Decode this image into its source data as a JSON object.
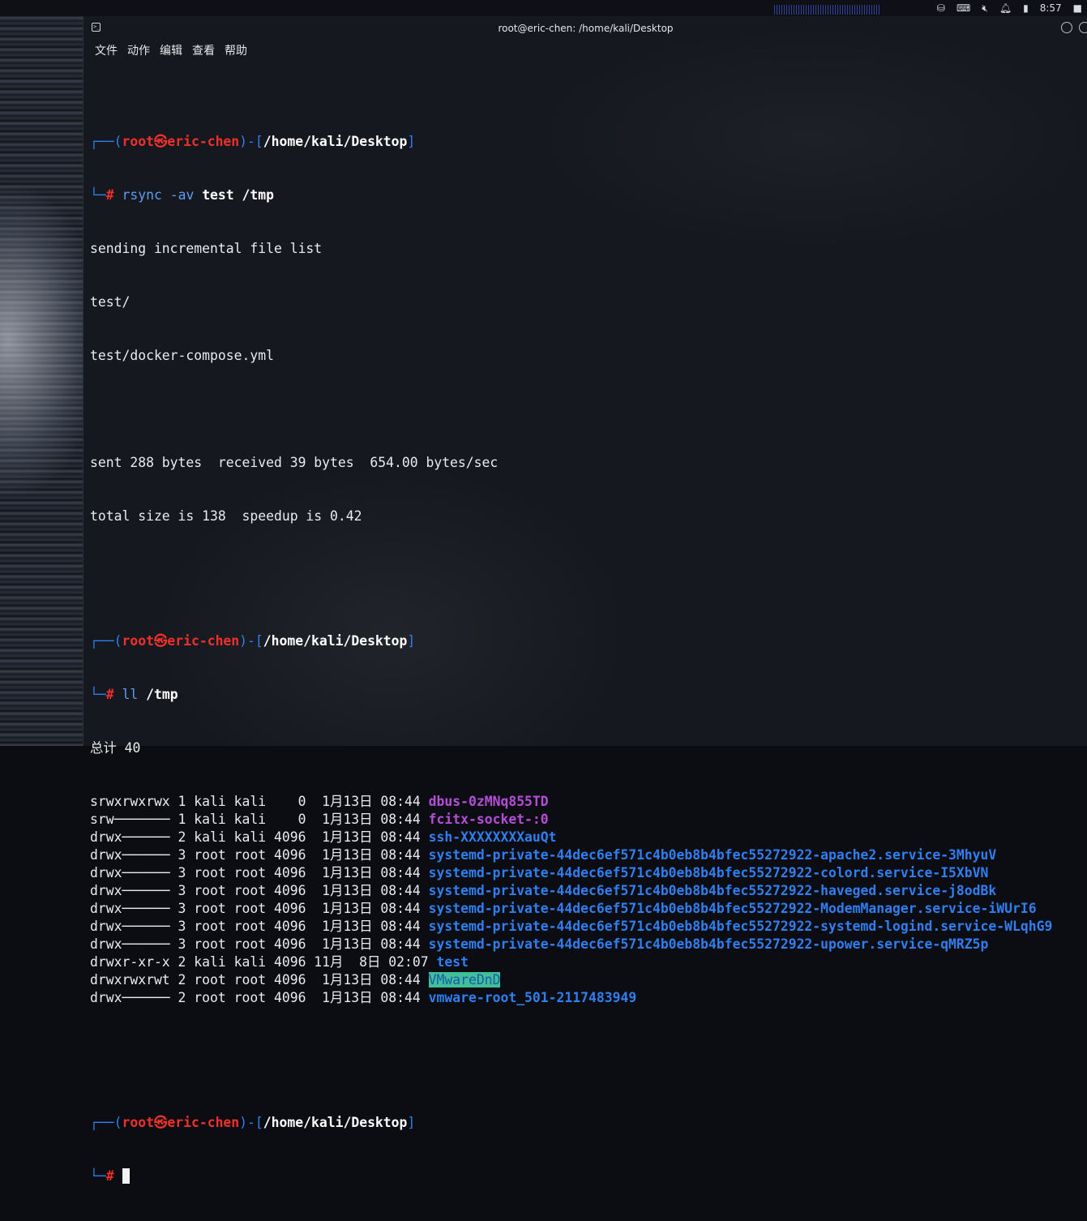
{
  "top_panel": {
    "clock": "8:57"
  },
  "window": {
    "title": "root@eric-chen: /home/kali/Desktop",
    "menu": [
      "文件",
      "动作",
      "编辑",
      "查看",
      "帮助"
    ]
  },
  "prompt": {
    "user": "root",
    "at": "㉿",
    "host": "eric-chen",
    "path": "/home/kali/Desktop",
    "symbol": "#"
  },
  "commands": [
    {
      "name": "rsync",
      "args": " -av ",
      "bold_args": "test /tmp"
    },
    {
      "name": "ll",
      "args": " ",
      "bold_args": "/tmp"
    }
  ],
  "rsync_output": [
    "sending incremental file list",
    "test/",
    "test/docker-compose.yml",
    "",
    "sent 288 bytes  received 39 bytes  654.00 bytes/sec",
    "total size is 138  speedup is 0.42"
  ],
  "ll_total": "总计 40",
  "ll_rows": [
    {
      "meta": "srwxrwxrwx 1 kali kali    0  1月13日 08:44 ",
      "name": "dbus-0zMNq855TD",
      "style": "mag"
    },
    {
      "meta": "srw─────── 1 kali kali    0  1月13日 08:44 ",
      "name": "fcitx-socket-:0",
      "style": "mag"
    },
    {
      "meta": "drwx────── 2 kali kali 4096  1月13日 08:44 ",
      "name": "ssh-XXXXXXXXauQt",
      "style": "dir"
    },
    {
      "meta": "drwx────── 3 root root 4096  1月13日 08:44 ",
      "name": "systemd-private-44dec6ef571c4b0eb8b4bfec55272922-apache2.service-3MhyuV",
      "style": "dir"
    },
    {
      "meta": "drwx────── 3 root root 4096  1月13日 08:44 ",
      "name": "systemd-private-44dec6ef571c4b0eb8b4bfec55272922-colord.service-I5XbVN",
      "style": "dir"
    },
    {
      "meta": "drwx────── 3 root root 4096  1月13日 08:44 ",
      "name": "systemd-private-44dec6ef571c4b0eb8b4bfec55272922-haveged.service-j8odBk",
      "style": "dir"
    },
    {
      "meta": "drwx────── 3 root root 4096  1月13日 08:44 ",
      "name": "systemd-private-44dec6ef571c4b0eb8b4bfec55272922-ModemManager.service-iWUrI6",
      "style": "dir"
    },
    {
      "meta": "drwx────── 3 root root 4096  1月13日 08:44 ",
      "name": "systemd-private-44dec6ef571c4b0eb8b4bfec55272922-systemd-logind.service-WLqhG9",
      "style": "dir"
    },
    {
      "meta": "drwx────── 3 root root 4096  1月13日 08:44 ",
      "name": "systemd-private-44dec6ef571c4b0eb8b4bfec55272922-upower.service-qMRZ5p",
      "style": "dir"
    },
    {
      "meta": "drwxr-xr-x 2 kali kali 4096 11月  8日 02:07 ",
      "name": "test",
      "style": "dir"
    },
    {
      "meta": "drwxrwxrwt 2 root root 4096  1月13日 08:44 ",
      "name": "VMwareDnD",
      "style": "hl"
    },
    {
      "meta": "drwx────── 2 root root 4096  1月13日 08:44 ",
      "name": "vmware-root_501-2117483949",
      "style": "dir"
    }
  ],
  "colors": {
    "prompt_frame": "#2f7ff0",
    "prompt_user": "#f0312b",
    "dir": "#2f7ff0",
    "socket": "#b64dd8",
    "sticky_bg": "#3fbf9a"
  }
}
